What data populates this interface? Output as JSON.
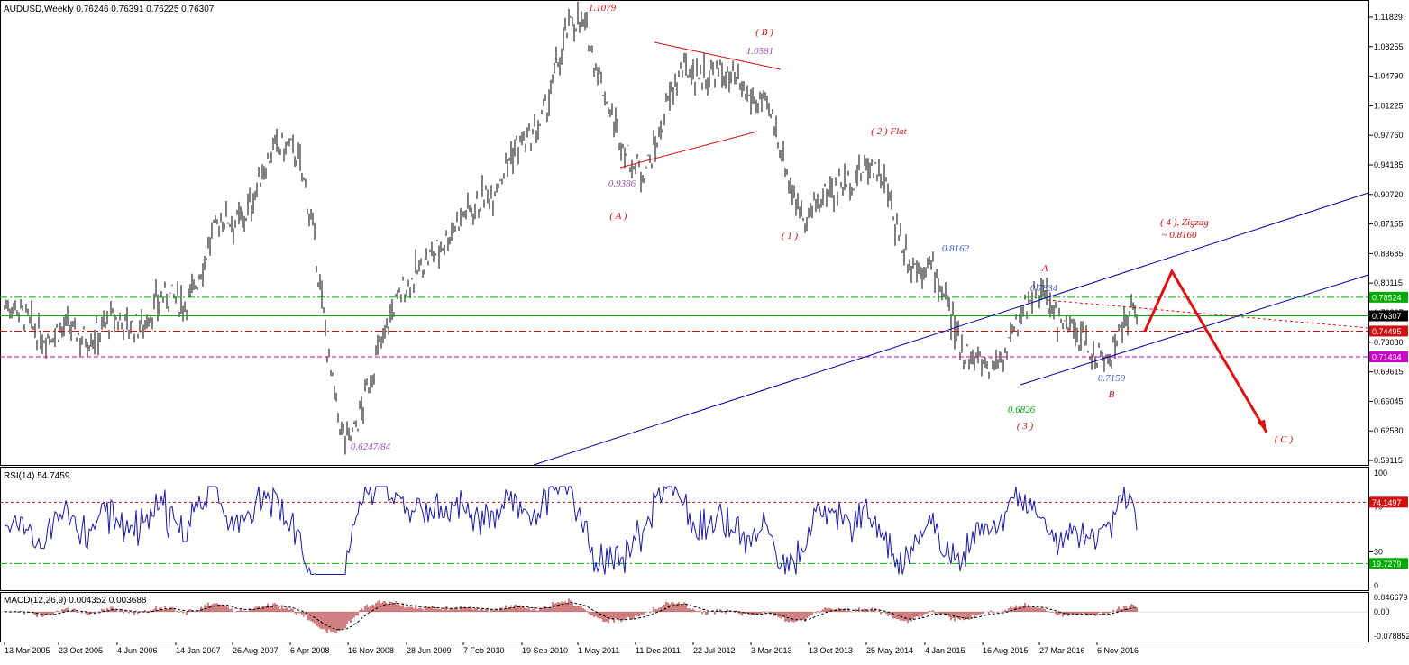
{
  "main": {
    "header": "AUDUSD,Weekly  0.76246 0.76391 0.76225 0.76307",
    "price_ticks": [
      "1.11829",
      "1.08255",
      "1.04790",
      "1.01225",
      "0.97760",
      "0.94185",
      "0.90720",
      "0.87155",
      "0.83685",
      "0.80115",
      "0.76307",
      "0.73080",
      "0.69615",
      "0.66045",
      "0.62580",
      "0.59115"
    ],
    "level_tags": [
      {
        "text": "0.78524",
        "color": "#00aa00"
      },
      {
        "text": "0.74495",
        "color": "#d01010"
      },
      {
        "text": "0.71434",
        "color": "#cc00cc"
      },
      {
        "text": "0.76307",
        "color": "#000000"
      }
    ],
    "annotations": [
      {
        "text": "1.1079",
        "color": "#d01010"
      },
      {
        "text": "( B )",
        "color": "#d01010"
      },
      {
        "text": "1.0581",
        "color": "#9a4fb0"
      },
      {
        "text": "0.9386",
        "color": "#9a4fb0"
      },
      {
        "text": "( A )",
        "color": "#d01010"
      },
      {
        "text": "( 1 )",
        "color": "#d01010"
      },
      {
        "text": "( 2 )  Flat",
        "color": "#d01010"
      },
      {
        "text": "0.8162",
        "color": "#3a5fcd"
      },
      {
        "text": "A",
        "color": "#d01010"
      },
      {
        "text": "0.7834",
        "color": "#3a5fcd"
      },
      {
        "text": "( 4 ), Zigzag",
        "color": "#d01010"
      },
      {
        "text": "~ 0.8160",
        "color": "#d01010"
      },
      {
        "text": "0.7159",
        "color": "#3a5fcd"
      },
      {
        "text": "B",
        "color": "#d01010"
      },
      {
        "text": "0.6826",
        "color": "#00aa00"
      },
      {
        "text": "( 3 )",
        "color": "#d01010"
      },
      {
        "text": "( C )",
        "color": "#d01010"
      },
      {
        "text": "0.6247/84",
        "color": "#9a4fb0"
      }
    ]
  },
  "rsi": {
    "header": "RSI(14) 54.7459",
    "ticks": [
      "100",
      "70",
      "30",
      "0"
    ],
    "level_tags": [
      {
        "text": "74.1497",
        "color": "#d01010"
      },
      {
        "text": "19.7279",
        "color": "#00aa00"
      }
    ]
  },
  "macd": {
    "header": "MACD(12,26,9) 0.004352 0.003688",
    "ticks": [
      "0.046679",
      "0.00",
      "-0.078852"
    ]
  },
  "time_axis": [
    "13 Mar 2005",
    "23 Oct 2005",
    "4 Jun 2006",
    "14 Jan 2007",
    "26 Aug 2007",
    "6 Apr 2008",
    "16 Nov 2008",
    "28 Jun 2009",
    "7 Feb 2010",
    "19 Sep 2010",
    "1 May 2011",
    "11 Dec 2011",
    "22 Jul 2012",
    "3 Mar 2013",
    "13 Oct 2013",
    "25 May 2014",
    "4 Jan 2015",
    "16 Aug 2015",
    "27 Mar 2016",
    "6 Nov 2016"
  ],
  "colors": {
    "candle": "#000000",
    "trend_blue": "#0000aa",
    "triangle_red": "#d01010",
    "forecast_red": "#dd1111",
    "rsi_line": "#1a1aa0",
    "macd_hist": "#a00000",
    "grid_line": "#000000"
  },
  "chart_data": [
    {
      "type": "line",
      "title": "AUDUSD,Weekly",
      "ohlc_last": {
        "open": 0.76246,
        "high": 0.76391,
        "low": 0.76225,
        "close": 0.76307
      },
      "ylim": [
        0.59115,
        1.11829
      ],
      "anchors": [
        {
          "x": "13 Mar 2005",
          "y": 0.77
        },
        {
          "x": "23 Oct 2005",
          "y": 0.74
        },
        {
          "x": "4 Jun 2006",
          "y": 0.75
        },
        {
          "x": "14 Jan 2007",
          "y": 0.78
        },
        {
          "x": "26 Aug 2007",
          "y": 0.88
        },
        {
          "x": "6 Apr 2008",
          "y": 0.97
        },
        {
          "x": "16 Nov 2008",
          "y": 0.6247
        },
        {
          "x": "28 Jun 2009",
          "y": 0.8
        },
        {
          "x": "7 Feb 2010",
          "y": 0.88
        },
        {
          "x": "19 Sep 2010",
          "y": 0.96
        },
        {
          "x": "1 May 2011",
          "y": 1.1079
        },
        {
          "x": "11 Dec 2011",
          "y": 0.9386
        },
        {
          "x": "22 Jul 2012",
          "y": 1.0581
        },
        {
          "x": "3 Mar 2013",
          "y": 1.03
        },
        {
          "x": "13 Oct 2013",
          "y": 0.89
        },
        {
          "x": "25 May 2014",
          "y": 0.94
        },
        {
          "x": "4 Jan 2015",
          "y": 0.8162
        },
        {
          "x": "16 Aug 2015",
          "y": 0.7
        },
        {
          "x": "27 Mar 2016",
          "y": 0.7834
        },
        {
          "x": "6 Nov 2016",
          "y": 0.7159
        }
      ],
      "horizontal_levels": [
        0.78524,
        0.76307,
        0.74495,
        0.71434
      ],
      "forecast_path": [
        0.74495,
        0.816,
        0.6247
      ]
    },
    {
      "type": "line",
      "title": "RSI(14)",
      "last_value": 54.7459,
      "ylim": [
        0,
        100
      ],
      "levels": [
        74.1497,
        19.7279
      ]
    },
    {
      "type": "bar",
      "title": "MACD(12,26,9)",
      "values": {
        "main": 0.004352,
        "signal": 0.003688
      },
      "ylim": [
        -0.078852,
        0.046679
      ]
    }
  ]
}
